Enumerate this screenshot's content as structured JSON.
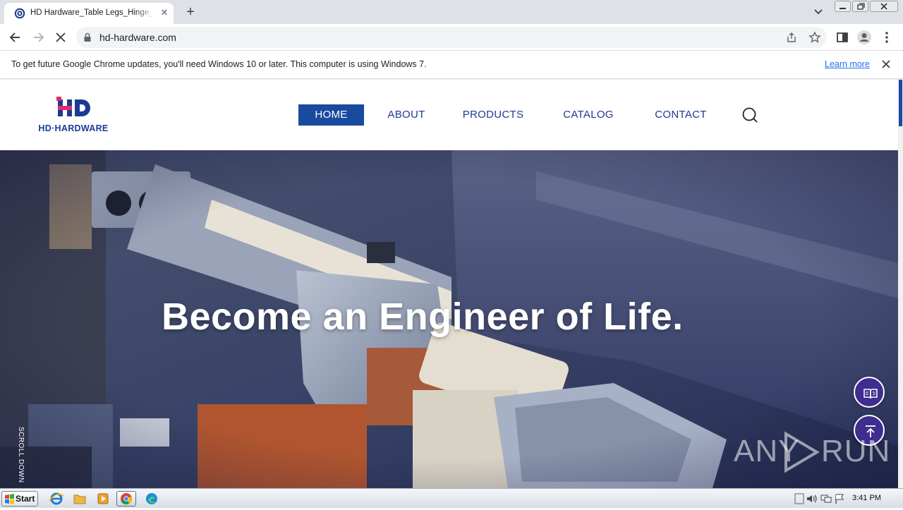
{
  "browser": {
    "tab_title": "HD Hardware_Table Legs_Hinge_Metal",
    "tab_close": "✕",
    "new_tab": "+",
    "url": "hd-hardware.com"
  },
  "infobar": {
    "message": "To get future Google Chrome updates, you'll need Windows 10 or later. This computer is using Windows 7.",
    "learn_more": "Learn more"
  },
  "site": {
    "logo_mark": "HD",
    "logo_text": "HD·HARDWARE",
    "nav": [
      {
        "label": "HOME",
        "active": true
      },
      {
        "label": "ABOUT",
        "active": false
      },
      {
        "label": "PRODUCTS",
        "active": false
      },
      {
        "label": "CATALOG",
        "active": false
      },
      {
        "label": "CONTACT",
        "active": false
      }
    ],
    "hero_headline": "Become an Engineer of Life.",
    "scroll_hint": "SCROLL DOWN",
    "watermark_left": "ANY",
    "watermark_right": "RUN"
  },
  "taskbar": {
    "start_label": "Start",
    "clock": "3:41 PM"
  },
  "colors": {
    "brand_blue": "#1b3a94",
    "nav_active_bg": "#1a4aa0",
    "logo_pink": "#e5286f",
    "float_button": "#3f2d8f"
  },
  "icons": {
    "back": "arrow-left-icon",
    "forward": "arrow-right-icon",
    "stop": "stop-x-icon",
    "lock": "lock-icon",
    "share": "share-icon",
    "bookmark": "star-icon",
    "sidepanel": "side-panel-icon",
    "profile": "person-icon",
    "menu": "kebab-menu-icon",
    "search": "search-icon",
    "catalog": "book-icon",
    "to_top": "arrow-up-to-top-icon"
  }
}
